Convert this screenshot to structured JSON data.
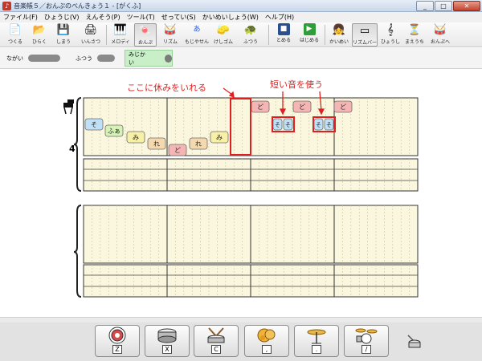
{
  "window": {
    "title": "音楽帳５／おんぷのべんきょう１ - [がくふ]",
    "min": "_",
    "max": "□",
    "close": "✕"
  },
  "menu": [
    "ファイル(F)",
    "ひょうじ(V)",
    "えんそう(P)",
    "ツール(T)",
    "せってい(S)",
    "かいめいしょう(W)",
    "ヘルプ(H)"
  ],
  "toolbar": [
    {
      "label": "つくる",
      "icon": "new-file-icon",
      "glyph": "📄"
    },
    {
      "label": "ひらく",
      "icon": "open-folder-icon",
      "glyph": "📂"
    },
    {
      "label": "しまう",
      "icon": "save-disk-icon",
      "glyph": "💾"
    },
    {
      "label": "いんさつ",
      "icon": "printer-icon",
      "glyph": "🖨"
    },
    {
      "label": "メロディ",
      "icon": "melody-icon",
      "glyph": "🎹"
    },
    {
      "label": "おんぷ",
      "icon": "note-icon",
      "glyph": "🍬"
    },
    {
      "label": "リズム",
      "icon": "rhythm-icon",
      "glyph": "🥁"
    },
    {
      "label": "もじやせん",
      "icon": "text-line-icon",
      "glyph": "あ"
    },
    {
      "label": "けしゴム",
      "icon": "eraser-icon",
      "glyph": "🧽"
    },
    {
      "label": "ふつう",
      "icon": "turtle-icon",
      "glyph": "🐢"
    },
    {
      "label": "とめる",
      "icon": "stop-icon",
      "glyph": "■"
    },
    {
      "label": "はじめる",
      "icon": "play-icon",
      "glyph": "▶"
    },
    {
      "label": "かいめい",
      "icon": "face-icon",
      "glyph": "👧"
    },
    {
      "label": "リズムバー",
      "icon": "rhythm-bar-icon",
      "glyph": "▭"
    },
    {
      "label": "ひょうし",
      "icon": "time-signature-icon",
      "glyph": "𝄞"
    },
    {
      "label": "まえうち",
      "icon": "metronome-icon",
      "glyph": "⏳"
    },
    {
      "label": "おんぷへ",
      "icon": "instrument-icon",
      "glyph": "🥁"
    }
  ],
  "tempo": {
    "slow": "ながい",
    "normal": "ふつう",
    "short": "みじかい"
  },
  "score": {
    "time_signature": "4",
    "annotation_rest": "ここに休みをいれる",
    "annotation_short": "短い音を使う",
    "notes": [
      {
        "label": "そ",
        "color": "#bfe0f7"
      },
      {
        "label": "ふぁ",
        "color": "#d6f2b6"
      },
      {
        "label": "み",
        "color": "#f7f0a6"
      },
      {
        "label": "れ",
        "color": "#f4d8b0"
      },
      {
        "label": "ど",
        "color": "#f5b5b5"
      },
      {
        "label": "れ",
        "color": "#f4d8b0"
      },
      {
        "label": "み",
        "color": "#f7f0a6"
      },
      {
        "label": "ど",
        "color": "#f5b5b5"
      },
      {
        "label": "そ",
        "color": "#bfe0f7"
      },
      {
        "label": "そ",
        "color": "#bfe0f7"
      },
      {
        "label": "ど",
        "color": "#f5b5b5"
      },
      {
        "label": "そ",
        "color": "#bfe0f7"
      },
      {
        "label": "そ",
        "color": "#bfe0f7"
      },
      {
        "label": "ど",
        "color": "#f5b5b5"
      }
    ],
    "accent": "#e02020"
  },
  "palette": [
    {
      "key": "Z",
      "icon": "bass-drum-icon"
    },
    {
      "key": "X",
      "icon": "snare-drum-icon"
    },
    {
      "key": "C",
      "icon": "drum-sticks-icon"
    },
    {
      "key": ",",
      "icon": "tambourine-icon"
    },
    {
      "key": ".",
      "icon": "cymbal-icon"
    },
    {
      "key": "/",
      "icon": "drum-kit-icon"
    }
  ]
}
